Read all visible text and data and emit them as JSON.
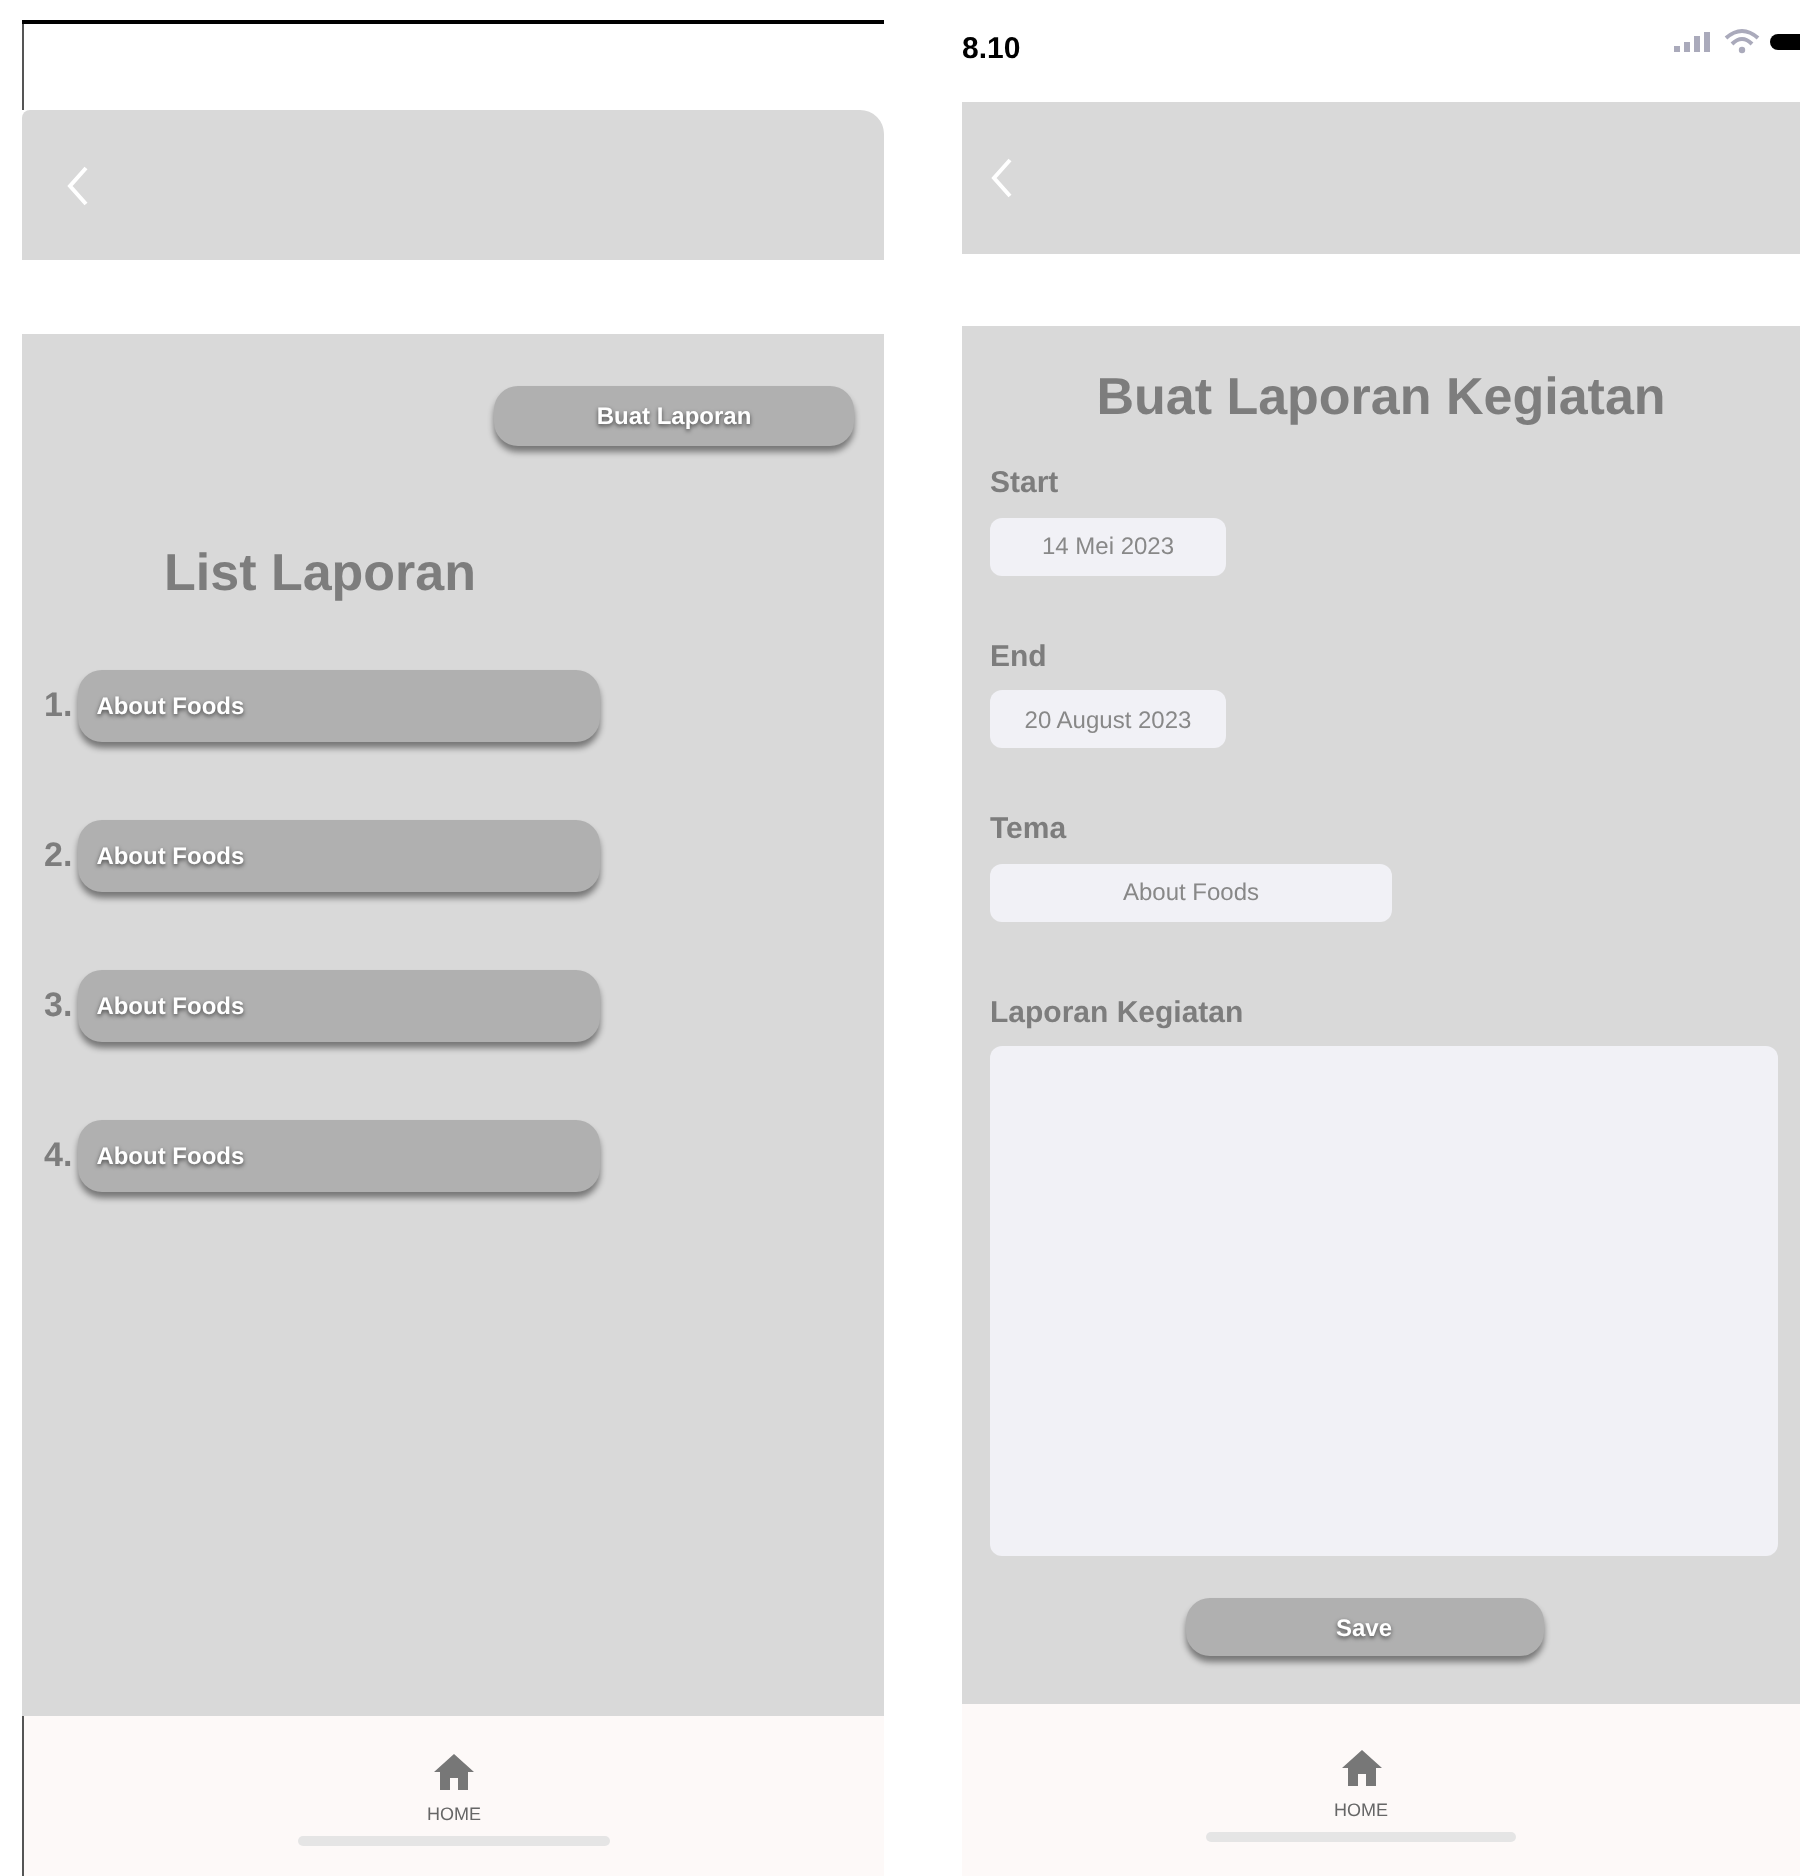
{
  "list_screen": {
    "action_button": "Buat Laporan",
    "title": "List Laporan",
    "items": [
      {
        "number": "1.",
        "label": "About Foods"
      },
      {
        "number": "2.",
        "label": "About Foods"
      },
      {
        "number": "3.",
        "label": "About Foods"
      },
      {
        "number": "4.",
        "label": "About Foods"
      }
    ],
    "nav": {
      "label": "HOME"
    }
  },
  "form_screen": {
    "status_bar": {
      "time": "8.10"
    },
    "title": "Buat Laporan Kegiatan",
    "fields": [
      {
        "kind": "date",
        "label": "Start",
        "value": "14 Mei 2023"
      },
      {
        "kind": "date",
        "label": "End",
        "value": "20 August 2023"
      },
      {
        "kind": "text",
        "label": "Tema",
        "value": "About Foods"
      },
      {
        "kind": "textarea",
        "label": "Laporan Kegiatan"
      }
    ],
    "save_button": "Save",
    "nav": {
      "label": "HOME"
    }
  }
}
